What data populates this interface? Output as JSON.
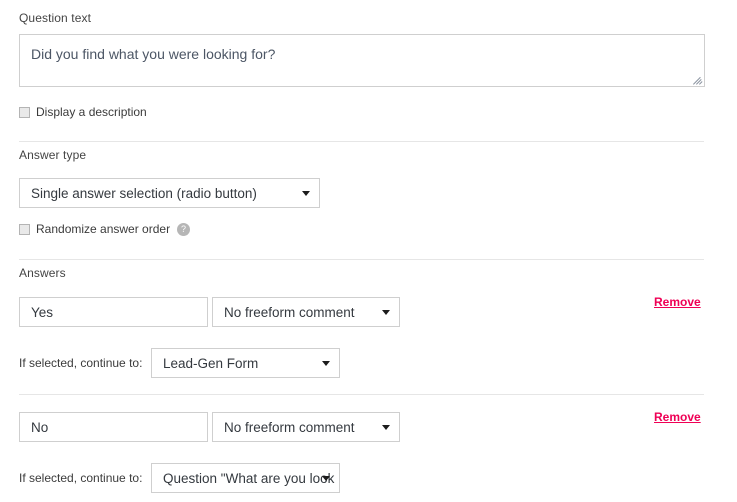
{
  "question": {
    "label": "Question text",
    "value": "Did you find what you were looking for?",
    "display_description": {
      "label": "Display a description",
      "checked": false
    }
  },
  "answer_type": {
    "label": "Answer type",
    "selected": "Single answer selection (radio button)",
    "randomize": {
      "label": "Randomize answer order",
      "checked": false,
      "help_icon": "help-circle-icon",
      "help_glyph": "?"
    }
  },
  "answers": {
    "label": "Answers",
    "continue_label": "If selected, continue to:",
    "remove_label": "Remove",
    "items": [
      {
        "text": "Yes",
        "comment_option": "No freeform comment",
        "continue_to": "Lead-Gen Form"
      },
      {
        "text": "No",
        "comment_option": "No freeform comment",
        "continue_to": "Question \"What are you look"
      }
    ]
  },
  "colors": {
    "remove_link": "#ef0055",
    "border": "#cfcfcf",
    "divider": "#e6e6e6",
    "label_text": "#444444",
    "value_text": "#34393f"
  },
  "icons": {
    "dropdown_arrow": "chevron-down-icon",
    "resize_grip": "resize-handle-icon"
  }
}
